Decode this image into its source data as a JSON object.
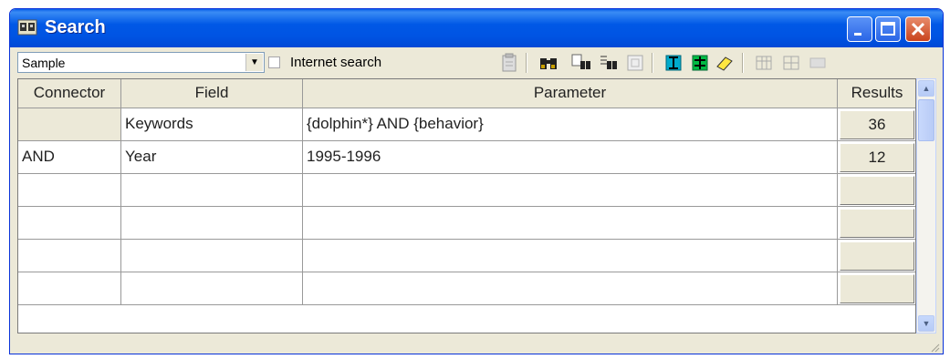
{
  "window": {
    "title": "Search",
    "accent": "#0054e3"
  },
  "toolbar": {
    "database_select": "Sample",
    "internet_search_label": "Internet search",
    "internet_search_checked": false,
    "icons": [
      "clipboard-icon",
      "binoculars-icon",
      "find-in-icon",
      "find-next-icon",
      "disabled-doc-icon",
      "insert-row-icon",
      "delete-row-icon",
      "eraser-icon",
      "table-icon",
      "table-grid-icon",
      "unknown-icon"
    ]
  },
  "grid": {
    "headers": [
      "Connector",
      "Field",
      "Parameter",
      "Results"
    ],
    "rows": [
      {
        "connector": "",
        "field": "Keywords",
        "parameter": "{dolphin*} AND {behavior}",
        "results": "36"
      },
      {
        "connector": "AND",
        "field": "Year",
        "parameter": "1995-1996",
        "results": "12"
      },
      {
        "connector": "",
        "field": "",
        "parameter": "",
        "results": ""
      },
      {
        "connector": "",
        "field": "",
        "parameter": "",
        "results": ""
      },
      {
        "connector": "",
        "field": "",
        "parameter": "",
        "results": ""
      },
      {
        "connector": "",
        "field": "",
        "parameter": "",
        "results": ""
      }
    ]
  }
}
